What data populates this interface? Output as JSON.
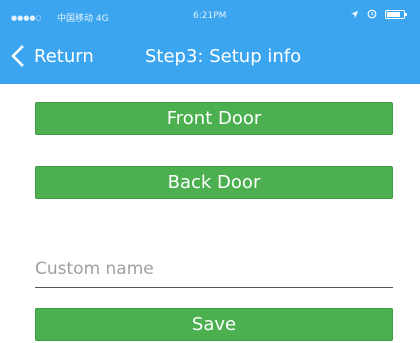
{
  "status_bar": {
    "signal": "●●●●○",
    "carrier": "中国移动 4G",
    "time": "6:21PM"
  },
  "nav": {
    "back_label": "Return",
    "title": "Step3: Setup info"
  },
  "buttons": {
    "front_door": "Front Door",
    "back_door": "Back Door",
    "save": "Save"
  },
  "custom_name": {
    "value": "",
    "placeholder": "Custom name"
  },
  "colors": {
    "header": "#3ba5f0",
    "button": "#4caf50"
  }
}
